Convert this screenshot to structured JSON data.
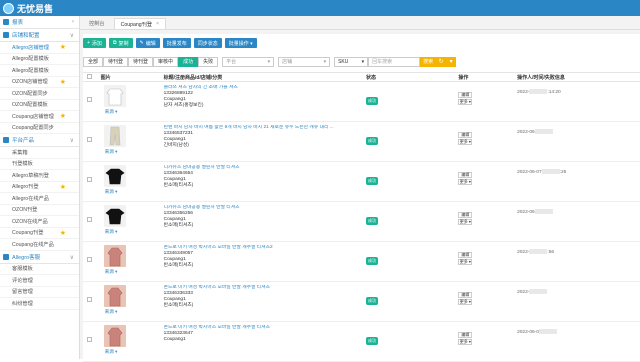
{
  "app": {
    "title": "无忧易售"
  },
  "sidebar": {
    "sections": [
      {
        "label": "报表",
        "items": []
      },
      {
        "label": "店铺和配置",
        "items": [
          {
            "label": "Allegro店铺管理",
            "starred": true,
            "active": true
          },
          {
            "label": "Allegro配置模板",
            "starred": false
          },
          {
            "label": "Allegro配置模板",
            "starred": false
          },
          {
            "label": "OZON店铺管理",
            "starred": true
          },
          {
            "label": "OZON配置同步",
            "starred": false
          },
          {
            "label": "OZON配置模板",
            "starred": false
          },
          {
            "label": "Coupang店铺管理",
            "starred": true
          },
          {
            "label": "Coupang配置同步",
            "starred": false
          }
        ]
      },
      {
        "label": "平台产品",
        "items": [
          {
            "label": "采集箱",
            "starred": false
          },
          {
            "label": "刊登模板",
            "starred": false
          },
          {
            "label": "Allegro草稿刊登",
            "starred": false
          },
          {
            "label": "Allegro刊登",
            "starred": true
          },
          {
            "label": "Allegro在线产品",
            "starred": false
          },
          {
            "label": "OZON刊登",
            "starred": false
          },
          {
            "label": "OZON在线产品",
            "starred": false
          },
          {
            "label": "Coupang刊登",
            "starred": true
          },
          {
            "label": "Coupang在线产品",
            "starred": false
          }
        ]
      },
      {
        "label": "Allegro客服",
        "items": [
          {
            "label": "客服模板",
            "starred": false
          },
          {
            "label": "评论管理",
            "starred": false
          },
          {
            "label": "留言管理",
            "starred": false
          },
          {
            "label": "纠纷管理",
            "starred": false
          }
        ]
      }
    ]
  },
  "tabs": [
    {
      "label": "控制台",
      "active": false
    },
    {
      "label": "Coupang刊登",
      "active": true
    }
  ],
  "toolbar": {
    "buttons": [
      {
        "label": "添加",
        "color": "#1ab394",
        "glyph": "+"
      },
      {
        "label": "复制",
        "color": "#1ab394",
        "glyph": "⧉"
      },
      {
        "label": "编辑",
        "color": "#2b86c5",
        "glyph": "✎"
      },
      {
        "label": "批量发布",
        "color": "#2b86c5",
        "glyph": ""
      },
      {
        "label": "同步状态",
        "color": "#2b86c5",
        "glyph": ""
      },
      {
        "label": "批量操作 ▾",
        "color": "#2b86c5",
        "glyph": ""
      }
    ]
  },
  "filters": {
    "status_tabs": [
      {
        "label": "全部",
        "active": false
      },
      {
        "label": "待刊登",
        "active": false
      },
      {
        "label": "待刊登",
        "active": false
      },
      {
        "label": "审核中",
        "active": false
      },
      {
        "label": "成功",
        "active": true
      },
      {
        "label": "失败",
        "active": false
      }
    ],
    "shop_select": "平台",
    "store_select": "店铺",
    "field_select": "SKU",
    "search_placeholder": "回车搜索",
    "search_label": "搜索"
  },
  "table": {
    "headers": [
      "图片",
      "标题/注册商品id/店铺/分类",
      "状态",
      "操作",
      "操作人/时间/失败信息"
    ],
    "rows": [
      {
        "img": "shirt-white",
        "title": "클라쓰 셔츠 남자의 긴 소매 가을 셔츠",
        "id": "13326889122",
        "shop": "Coupang1",
        "cat": "남자 셔츠(홍정보킨)",
        "status": "成功",
        "time": "2022-",
        "time2": ":14:20"
      },
      {
        "img": "pants-beige",
        "title": "탄쌘 바지 남자 바지 여름 얇은 9개 바지 남자 바지 21 새로운 유수 느슨한 캐쥬 대리 ...",
        "id": "13346537231",
        "shop": "Coupang1",
        "cat": "긴바지(남성)",
        "status": "成功",
        "time": "2022-06",
        "time2": ""
      },
      {
        "img": "tshirt-black",
        "title": "디카쥬즈 남녀공용 멀린사 반팔 티셔츠",
        "id": "13346364654",
        "shop": "Coupang1",
        "cat": "반소매(티셔츠)",
        "status": "成功",
        "time": "2022-06-07",
        "time2": ":25"
      },
      {
        "img": "tshirt-black",
        "title": "디카쥬즈 남녀공용 멀린사 반팔 티셔츠",
        "id": "13346356256",
        "shop": "Coupang1",
        "cat": "반소매(티셔츠)",
        "status": "成功",
        "time": "2022-06",
        "time2": ""
      },
      {
        "img": "tshirt-skin",
        "title": "손드로 미키 여성 박시아즈 모바일 반팔 캐주얼 티셔츠2",
        "id": "13346349057",
        "shop": "Coupang1",
        "cat": "반소매(티셔츠)",
        "status": "成功",
        "time": "2022-",
        "time2": ":56"
      },
      {
        "img": "tshirt-skin",
        "title": "손드로 미키 여성 박시아즈 모바일 반팔 캐주얼 티셔츠",
        "id": "13346336333",
        "shop": "Coupang1",
        "cat": "반소매(티셔츠)",
        "status": "成功",
        "time": "2022-",
        "time2": ""
      },
      {
        "img": "tshirt-skin",
        "title": "손드로 미키 여성 박시아즈 모바일 반팔 캐주얼 티셔츠",
        "id": "13346323647",
        "shop": "Coupang1",
        "cat": "",
        "status": "成功",
        "time": "2022-06-0",
        "time2": ""
      }
    ],
    "source_label": "来源 ▾",
    "edit_label": "编辑",
    "more_label": "更多 ▾"
  }
}
